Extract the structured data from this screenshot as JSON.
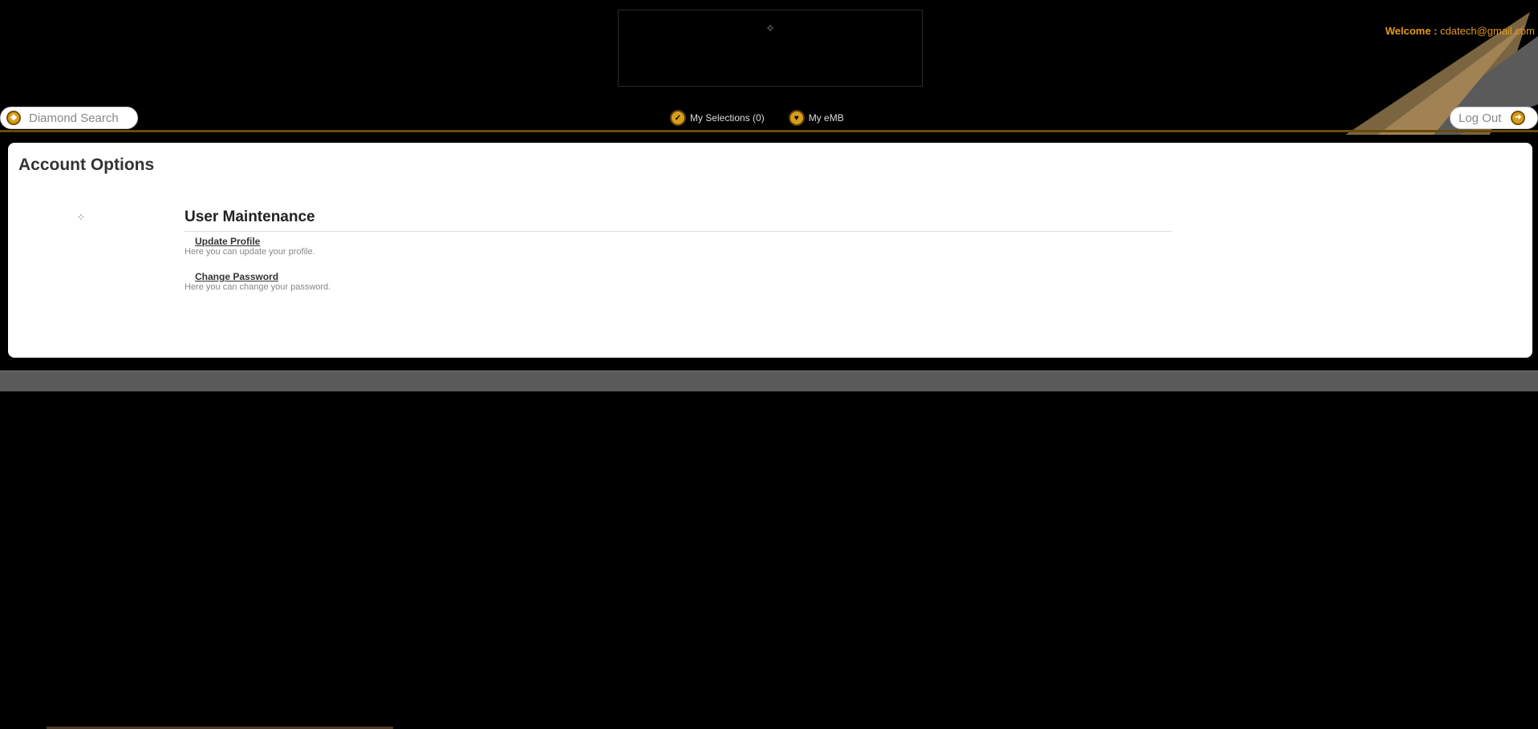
{
  "header": {
    "logo": {
      "mark": "✧",
      "main": "",
      "sub": ""
    },
    "welcome_label": "Welcome :",
    "welcome_email": "cdatech@gmail.com",
    "diamond_search_label": "Diamond Search",
    "logout_label": "Log Out",
    "nav": [
      {
        "label": "My Selections (0)"
      },
      {
        "label": "My eMB"
      }
    ]
  },
  "colors": {
    "accent": "#e59a1c",
    "coin": "#d89e1a",
    "gold_line": "#6a4a0a",
    "footer": "#5a5a5a"
  },
  "icons": {
    "diamond_search": "coin-icon",
    "logout": "coin-icon",
    "selections": "check-coin-icon",
    "emb": "heart-coin-icon",
    "section": "bullet-icon"
  },
  "main": {
    "title": "Account Options",
    "section": {
      "heading": "User Maintenance",
      "options": [
        {
          "label": "Update Profile",
          "description": "Here you can update your profile."
        },
        {
          "label": "Change Password",
          "description": "Here you can change your password."
        }
      ]
    }
  },
  "footer": {
    "text": ""
  }
}
